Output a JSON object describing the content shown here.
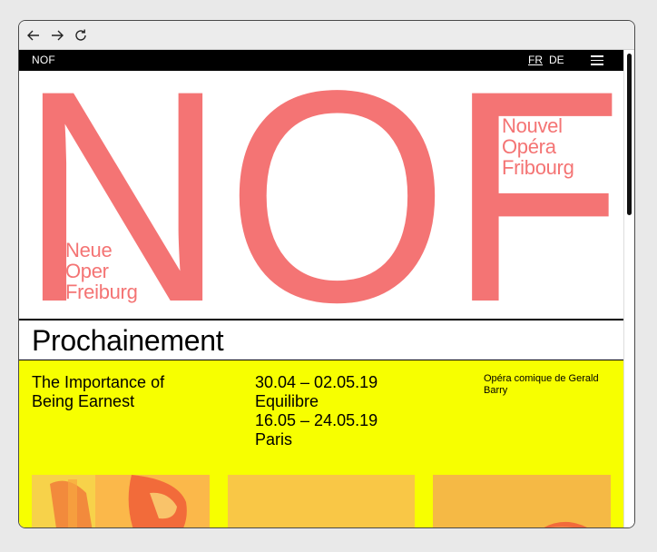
{
  "browser": {
    "back_icon": "arrow-left-icon",
    "forward_icon": "arrow-right-icon",
    "reload_icon": "reload-icon"
  },
  "site": {
    "brand": "NOF",
    "languages": [
      "FR",
      "DE"
    ],
    "active_language": "FR",
    "menu_icon": "hamburger-menu-icon"
  },
  "hero": {
    "logo_text": "NOF",
    "name_de": [
      "Neue",
      "Oper",
      "Freiburg"
    ],
    "name_fr": [
      "Nouvel",
      "Opéra",
      "Fribourg"
    ]
  },
  "section": {
    "title": "Prochainement"
  },
  "event": {
    "title_lines": [
      "The Importance of",
      "Being Earnest"
    ],
    "dates": [
      "30.04 – 02.05.19",
      "Equilibre",
      "16.05 – 24.05.19",
      "Paris"
    ],
    "description": "Opéra comique de Gerald Barry"
  },
  "colors": {
    "accent": "#f47474",
    "highlight": "#f7ff00",
    "bar": "#000000"
  }
}
